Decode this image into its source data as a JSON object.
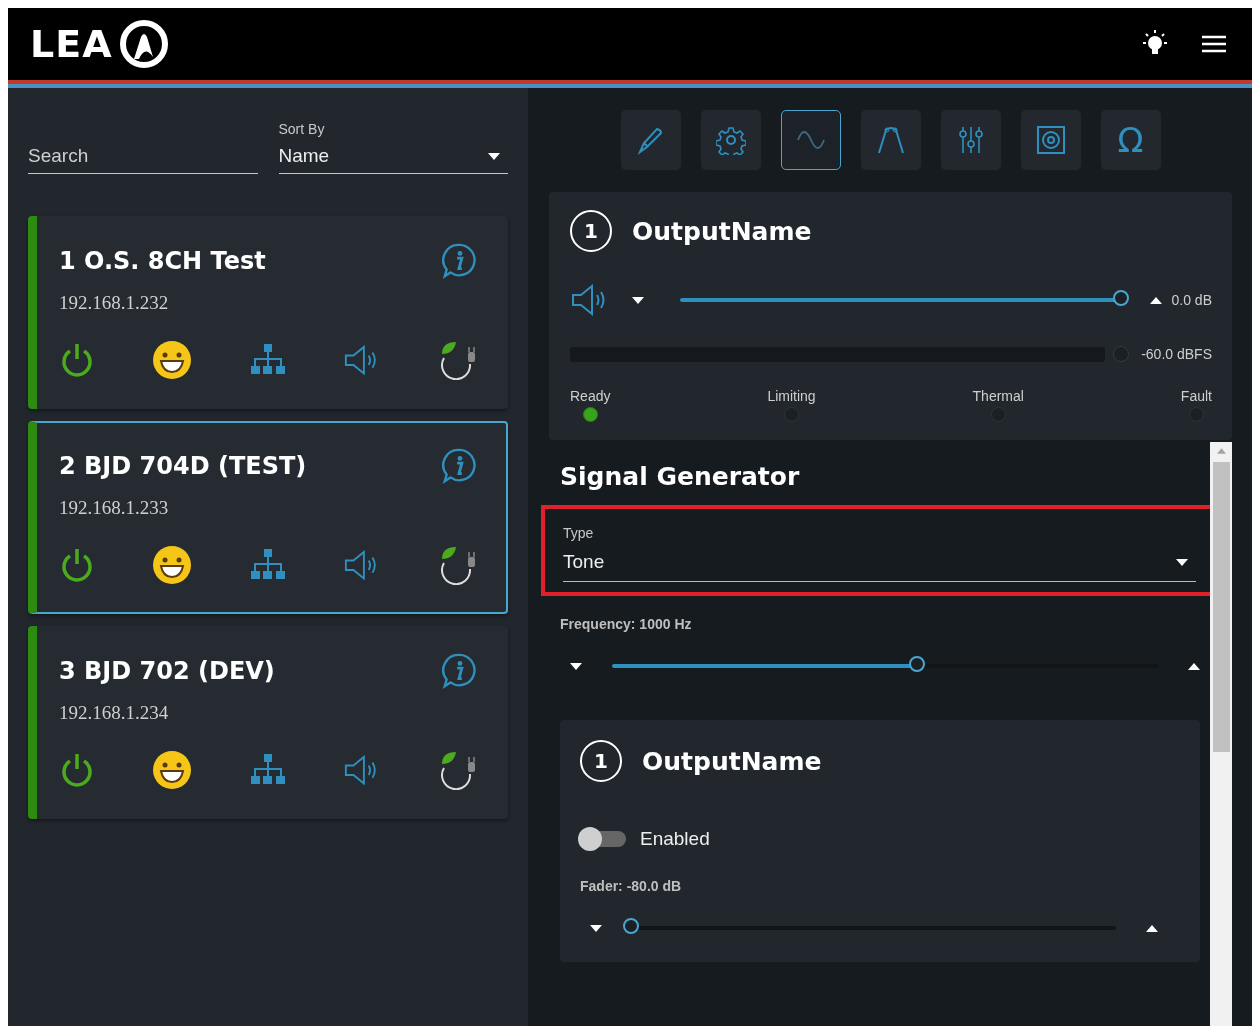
{
  "header": {
    "logo": "LEA"
  },
  "search": {
    "placeholder": "Search"
  },
  "sort": {
    "label": "Sort By",
    "value": "Name"
  },
  "devices": [
    {
      "name": "1 O.S. 8CH Test",
      "ip": "192.168.1.232",
      "selected": false
    },
    {
      "name": "2 BJD 704D (TEST)",
      "ip": "192.168.1.233",
      "selected": true
    },
    {
      "name": "3 BJD 702 (DEV)",
      "ip": "192.168.1.234",
      "selected": false
    }
  ],
  "toolbar": [
    {
      "kind": "pen",
      "selected": false
    },
    {
      "kind": "gear",
      "selected": false
    },
    {
      "kind": "wave",
      "selected": true
    },
    {
      "kind": "filter",
      "selected": false
    },
    {
      "kind": "mixer",
      "selected": false
    },
    {
      "kind": "speaker-box",
      "selected": false
    },
    {
      "kind": "omega",
      "symbol": "Ω",
      "selected": false
    }
  ],
  "output": {
    "number": "1",
    "name": "OutputName",
    "level": 1.0,
    "reading": "0.0 dB",
    "meter_reading": "-60.0 dBFS",
    "statuses": [
      {
        "label": "Ready",
        "on": true
      },
      {
        "label": "Limiting",
        "on": false
      },
      {
        "label": "Thermal",
        "on": false
      },
      {
        "label": "Fault",
        "on": false
      }
    ]
  },
  "signal_generator": {
    "title": "Signal Generator",
    "type": {
      "label": "Type",
      "value": "Tone",
      "highlighted": true
    },
    "frequency": {
      "label": "Frequency: 1000 Hz",
      "level": 0.56
    }
  },
  "channel": {
    "number": "1",
    "name": "OutputName",
    "enabled": false,
    "enabled_label": "Enabled",
    "fader": {
      "label": "Fader: -80.0 dB",
      "level": 0
    }
  }
}
